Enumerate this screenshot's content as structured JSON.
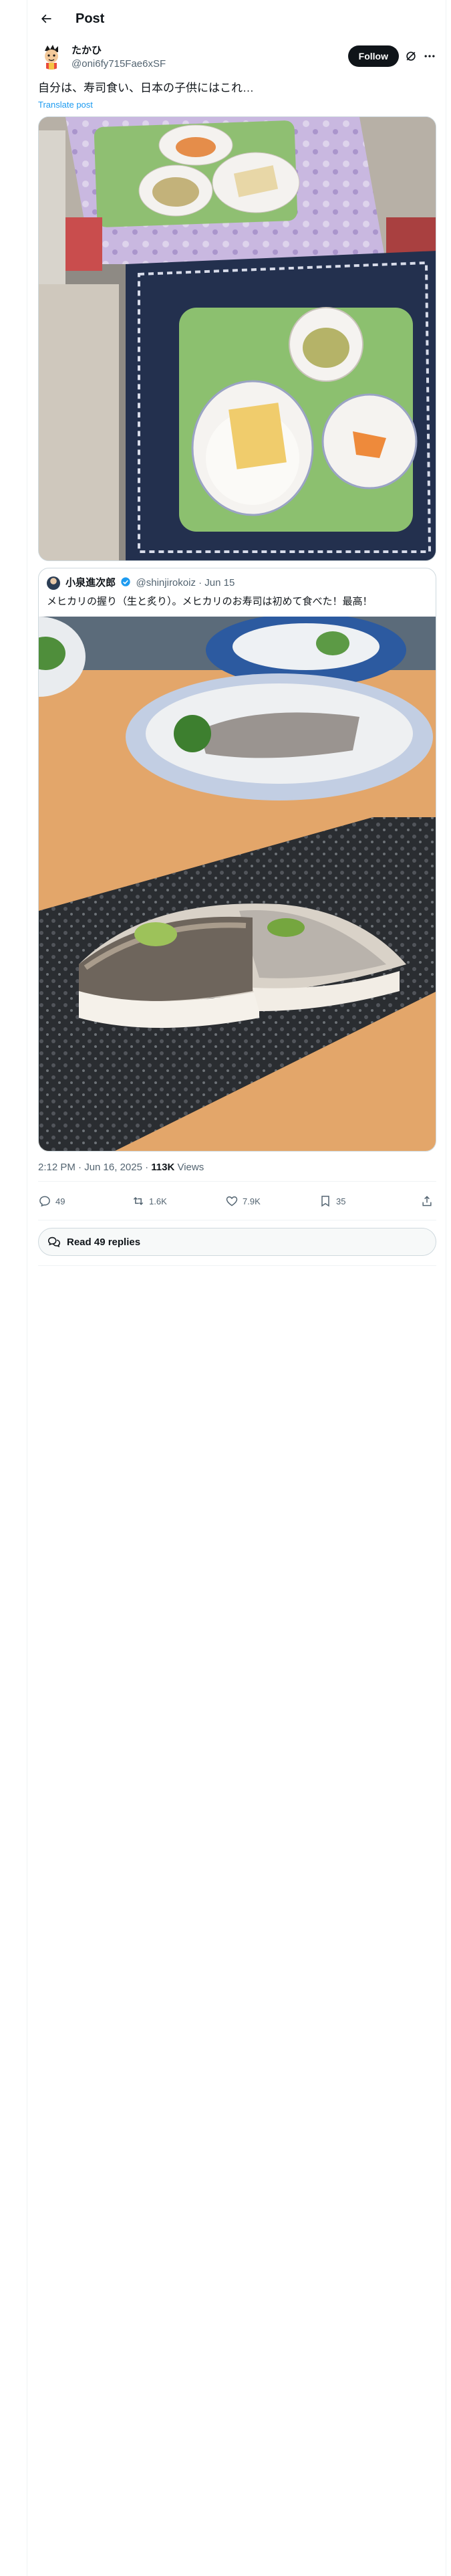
{
  "header": {
    "title": "Post"
  },
  "author": {
    "name": "たかひ",
    "handle": "@oni6fy715Fae6xSF",
    "follow_label": "Follow"
  },
  "tweet": {
    "text": "自分は、寿司食い、日本の子供にはこれ…",
    "translate_label": "Translate post"
  },
  "quote": {
    "name": "小泉進次郎",
    "handle": "@shinjirokoiz",
    "separator": "·",
    "date": "Jun 15",
    "text": "メヒカリの握り（生と炙り）。メヒカリのお寿司は初めて食べた！最高！"
  },
  "meta": {
    "time": "2:12 PM · Jun 16, 2025 · ",
    "views_count": "113K",
    "views_label": " Views"
  },
  "actions": {
    "replies": "49",
    "reposts": "1.6K",
    "likes": "7.9K",
    "bookmarks": "35"
  },
  "read_replies": {
    "label": "Read 49 replies"
  },
  "colors": {
    "accent": "#1d9bf0",
    "text": "#0f1419",
    "secondary": "#536471",
    "border": "#cfd9de"
  },
  "icons": [
    "back-arrow-icon",
    "grok-icon",
    "more-icon",
    "verified-icon",
    "reply-icon",
    "repost-icon",
    "like-icon",
    "bookmark-icon",
    "share-icon",
    "replies-bubble-icon"
  ]
}
